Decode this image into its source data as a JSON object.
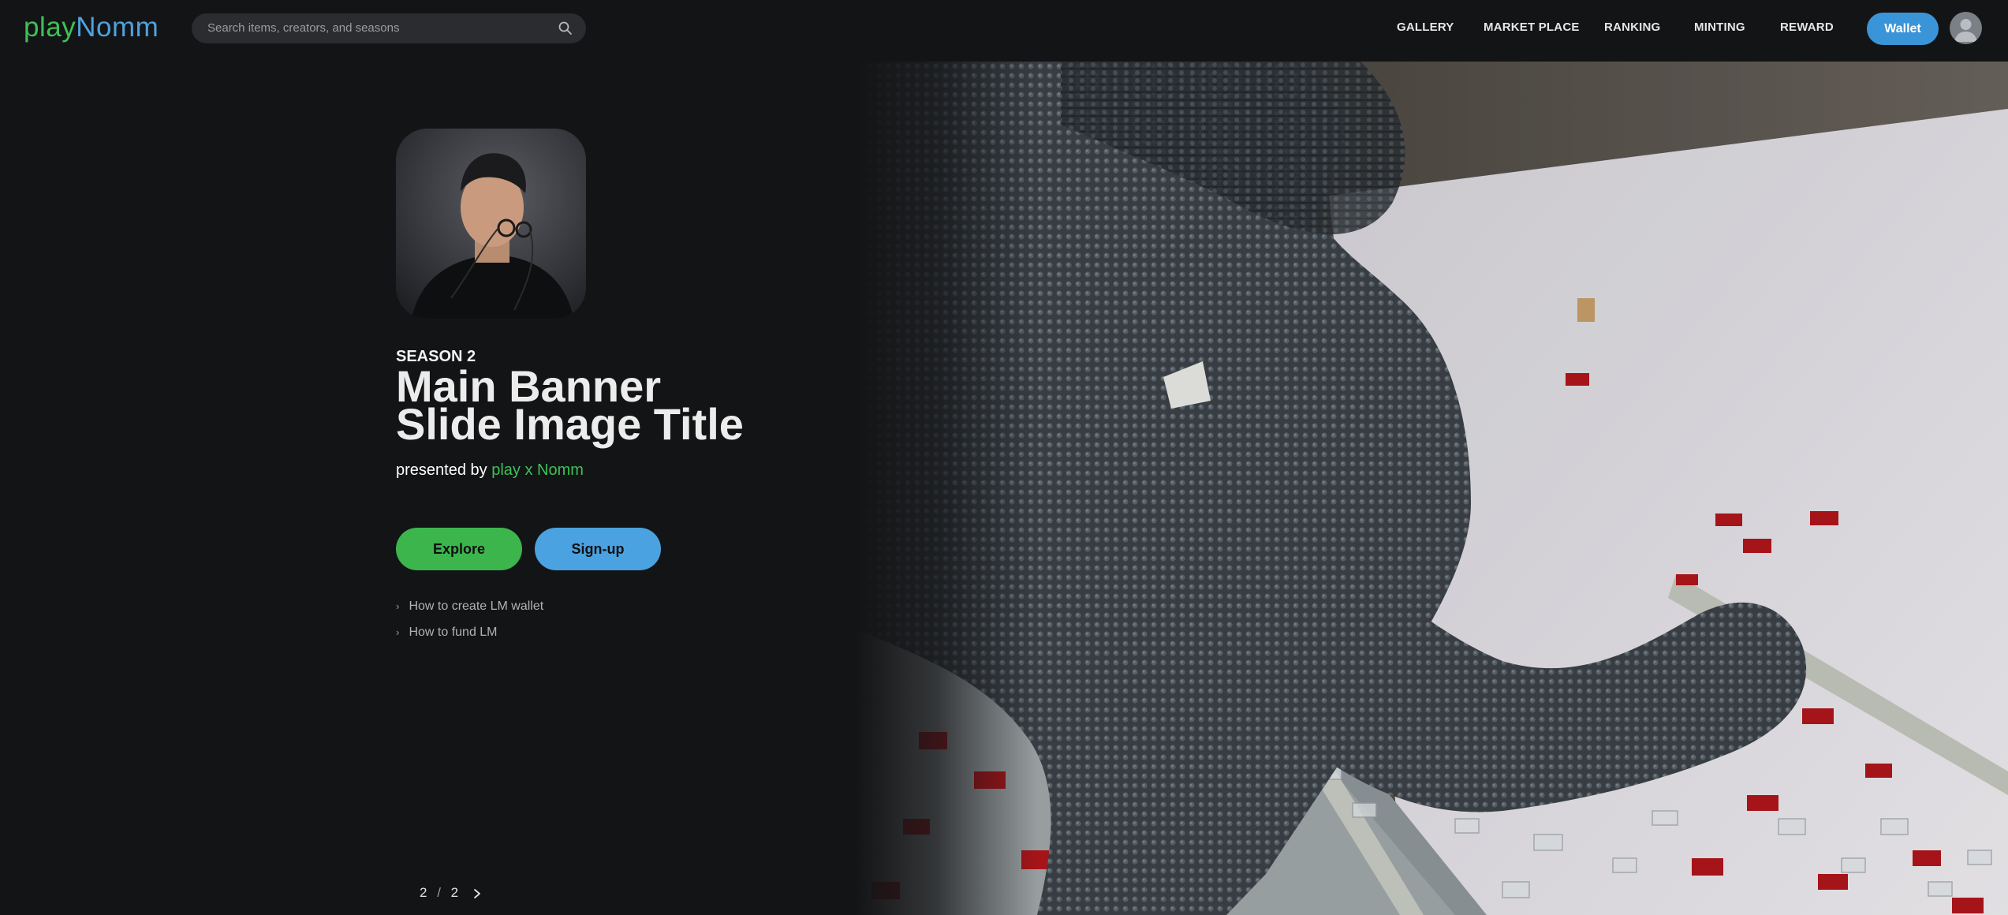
{
  "header": {
    "logo_part1": "play",
    "logo_part2": "Nomm",
    "search_placeholder": "Search items, creators, and seasons",
    "nav": [
      "GALLERY",
      "MARKET PLACE",
      "RANKING",
      "MINTING",
      "REWARD"
    ],
    "wallet_label": "Wallet"
  },
  "hero": {
    "season": "SEASON 2",
    "title_line1": "Main Banner",
    "title_line2": "Slide Image Title",
    "presented_prefix": "presented by",
    "presented_brand": "play x Nomm",
    "explore_label": "Explore",
    "signup_label": "Sign-up",
    "links": [
      "How to create LM wallet",
      "How to fund LM"
    ]
  },
  "pager": {
    "current": "2",
    "separator": "/",
    "total": "2"
  },
  "colors": {
    "background": "#131416",
    "brand_green": "#3cb54d",
    "brand_blue": "#4aa2e0"
  }
}
